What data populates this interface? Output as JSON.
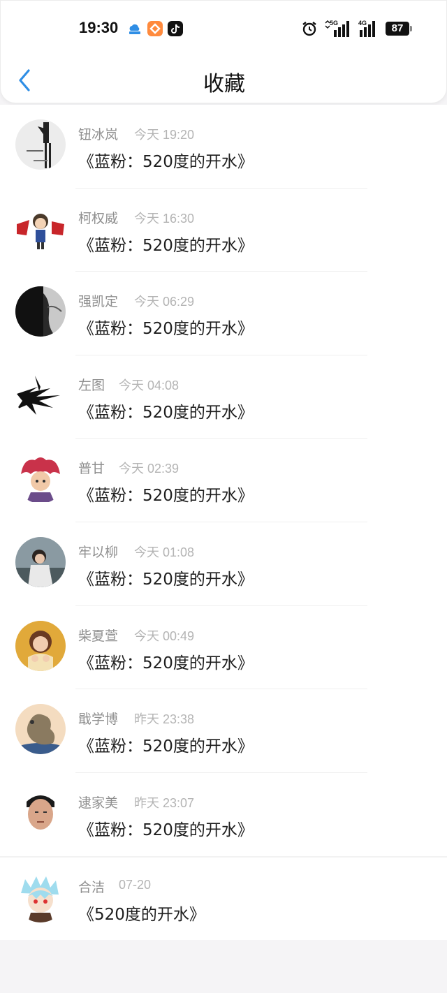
{
  "status": {
    "time": "19:30",
    "net1": "5G",
    "net2": "4G",
    "battery": "87"
  },
  "nav": {
    "title": "收藏"
  },
  "items": [
    {
      "name": "钮冰岚",
      "time": "今天 19:20",
      "content": "《蓝粉：520度的开水》"
    },
    {
      "name": "柯权威",
      "time": "今天 16:30",
      "content": "《蓝粉：520度的开水》"
    },
    {
      "name": "强凯定",
      "time": "今天 06:29",
      "content": "《蓝粉：520度的开水》"
    },
    {
      "name": "左图",
      "time": "今天 04:08",
      "content": "《蓝粉：520度的开水》"
    },
    {
      "name": "普甘",
      "time": "今天 02:39",
      "content": "《蓝粉：520度的开水》"
    },
    {
      "name": "牢以柳",
      "time": "今天 01:08",
      "content": "《蓝粉：520度的开水》"
    },
    {
      "name": "柴夏萱",
      "time": "今天 00:49",
      "content": "《蓝粉：520度的开水》"
    },
    {
      "name": "戢学博",
      "time": "昨天 23:38",
      "content": "《蓝粉：520度的开水》"
    },
    {
      "name": "逮家美",
      "time": "昨天 23:07",
      "content": "《蓝粉：520度的开水》"
    },
    {
      "name": "合洁",
      "time": "07-20",
      "content": "《520度的开水》"
    }
  ],
  "colors": {
    "accent": "#2f8ee5",
    "name": "#8f8f8f",
    "time": "#b4b4b4",
    "content": "#1e1e1e"
  }
}
